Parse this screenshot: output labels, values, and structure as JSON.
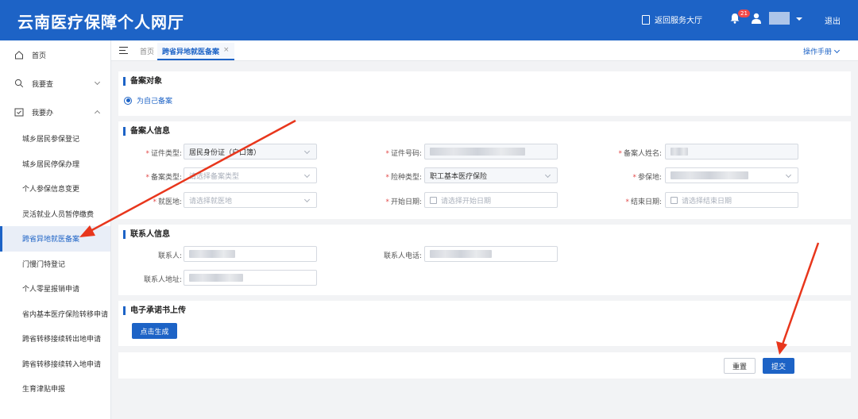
{
  "header": {
    "title": "云南医疗保障个人网厅",
    "return_label": "返回服务大厅",
    "badge_count": "21",
    "logout_label": "退出"
  },
  "sidebar": {
    "home_label": "首页",
    "query_label": "我要查",
    "do_label": "我要办",
    "items": [
      {
        "label": "城乡居民参保登记"
      },
      {
        "label": "城乡居民停保办理"
      },
      {
        "label": "个人参保信息变更"
      },
      {
        "label": "灵活就业人员暂停缴费"
      },
      {
        "label": "跨省异地就医备案"
      },
      {
        "label": "门慢门特登记"
      },
      {
        "label": "个人零星报销申请"
      },
      {
        "label": "省内基本医疗保险转移申请"
      },
      {
        "label": "跨省转移接续转出地申请"
      },
      {
        "label": "跨省转移接续转入地申请"
      },
      {
        "label": "生育津贴申报"
      }
    ]
  },
  "tabs": {
    "home_label": "首页",
    "active_label": "跨省异地就医备案",
    "close_glyph": "×",
    "manual_label": "操作手册"
  },
  "sections": {
    "target_title": "备案对象",
    "target_option": "为自己备案",
    "person_title": "备案人信息",
    "contact_title": "联系人信息",
    "upload_title": "电子承诺书上传"
  },
  "form": {
    "id_type_label": "证件类型:",
    "id_type_value": "居民身份证（户口簿）",
    "id_number_label": "证件号码:",
    "name_label": "备案人姓名:",
    "filing_type_label": "备案类型:",
    "filing_type_placeholder": "请选择备案类型",
    "insurance_type_label": "险种类型:",
    "insurance_type_value": "职工基本医疗保险",
    "insured_place_label": "参保地:",
    "medical_place_label": "就医地:",
    "medical_place_placeholder": "请选择就医地",
    "start_date_label": "开始日期:",
    "start_date_placeholder": "请选择开始日期",
    "end_date_label": "结束日期:",
    "end_date_placeholder": "请选择结束日期",
    "contact_label": "联系人:",
    "contact_phone_label": "联系人电话:",
    "contact_address_label": "联系人地址:"
  },
  "buttons": {
    "generate_label": "点击生成",
    "reset_label": "重置",
    "submit_label": "提交"
  },
  "colors": {
    "brand": "#1d63c6",
    "arrow": "#e8361c",
    "required": "#e24a4a"
  }
}
